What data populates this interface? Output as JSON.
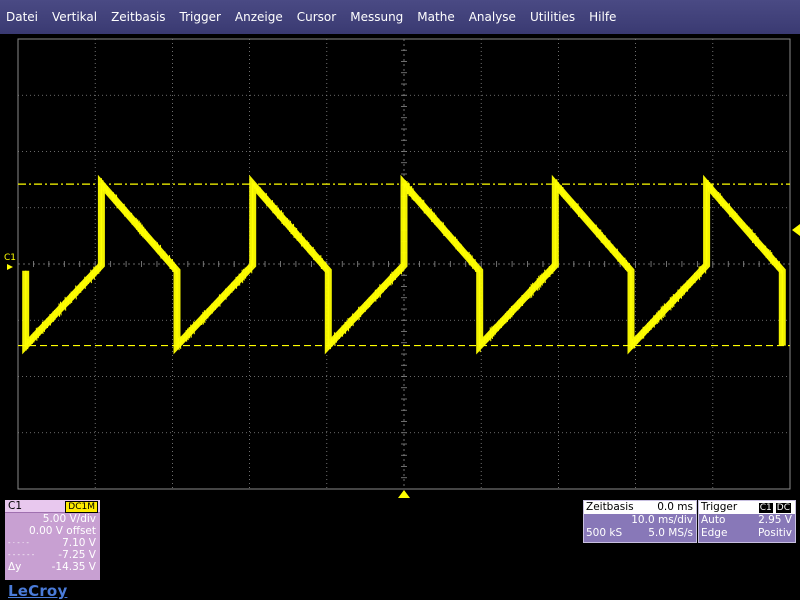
{
  "menu": {
    "items": [
      "Datei",
      "Vertikal",
      "Zeitbasis",
      "Trigger",
      "Anzeige",
      "Cursor",
      "Messung",
      "Mathe",
      "Analyse",
      "Utilities",
      "Hilfe"
    ]
  },
  "screen": {
    "channel_marker": "C1",
    "colors": {
      "trace": "#ffff00",
      "grid": "#8a8a8a",
      "background": "#000000",
      "cursor": "#ffff00"
    },
    "cursors": {
      "upper_level_v": 7.1,
      "lower_level_v": -7.25
    },
    "trace": {
      "type": "sawtooth-up-down",
      "high_v": 7.1,
      "low_v": -7.25,
      "mid_v": -0.3,
      "period_ms": 19.6
    }
  },
  "channel_panel": {
    "label": "C1",
    "coupling": "DC1M",
    "vdiv": "5.00 V/div",
    "offset": "0.00 V offset",
    "cursor1_symbol": "- · - · -",
    "cursor1_value": "7.10 V",
    "cursor2_symbol": "- - - - - -",
    "cursor2_value": "-7.25 V",
    "delta_label": "Δy",
    "delta_value": "-14.35 V"
  },
  "logo": "LeCroy",
  "timebase_panel": {
    "title": "Zeitbasis",
    "delay": "0.0 ms",
    "tdiv": "10.0 ms/div",
    "samples": "500 kS",
    "rate": "5.0 MS/s"
  },
  "trigger_panel": {
    "title": "Trigger",
    "source": "C1",
    "coupling": "DC",
    "mode": "Auto",
    "level": "2.95 V",
    "type": "Edge",
    "slope": "Positiv"
  }
}
